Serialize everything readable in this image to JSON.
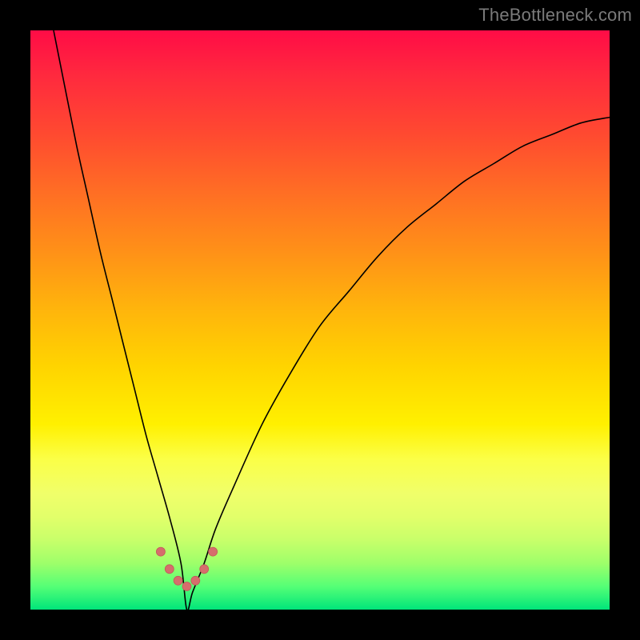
{
  "watermark": "TheBottleneck.com",
  "colors": {
    "frame": "#000000",
    "gradient_top": "#ff0c46",
    "gradient_bottom": "#00e57a",
    "curve": "#000000",
    "dot": "#d66d6c"
  },
  "chart_data": {
    "type": "line",
    "title": "",
    "xlabel": "",
    "ylabel": "",
    "xlim": [
      0,
      100
    ],
    "ylim": [
      0,
      100
    ],
    "note": "Axes are unlabeled in the image; values are estimated as percent of plot area. Minimum of curve near x≈27, y≈0. Background color encodes y (green=low, red=high).",
    "series": [
      {
        "name": "curve",
        "x": [
          4,
          6,
          8,
          10,
          12,
          14,
          16,
          18,
          20,
          22,
          24,
          26,
          27,
          28,
          30,
          32,
          35,
          40,
          45,
          50,
          55,
          60,
          65,
          70,
          75,
          80,
          85,
          90,
          95,
          100
        ],
        "y": [
          100,
          90,
          80,
          71,
          62,
          54,
          46,
          38,
          30,
          23,
          16,
          8,
          0,
          3,
          8,
          14,
          21,
          32,
          41,
          49,
          55,
          61,
          66,
          70,
          74,
          77,
          80,
          82,
          84,
          85
        ]
      },
      {
        "name": "dots",
        "x": [
          22.5,
          24.0,
          25.5,
          27.0,
          28.5,
          30.0,
          31.5
        ],
        "y": [
          10.0,
          7.0,
          5.0,
          4.0,
          5.0,
          7.0,
          10.0
        ]
      }
    ]
  }
}
